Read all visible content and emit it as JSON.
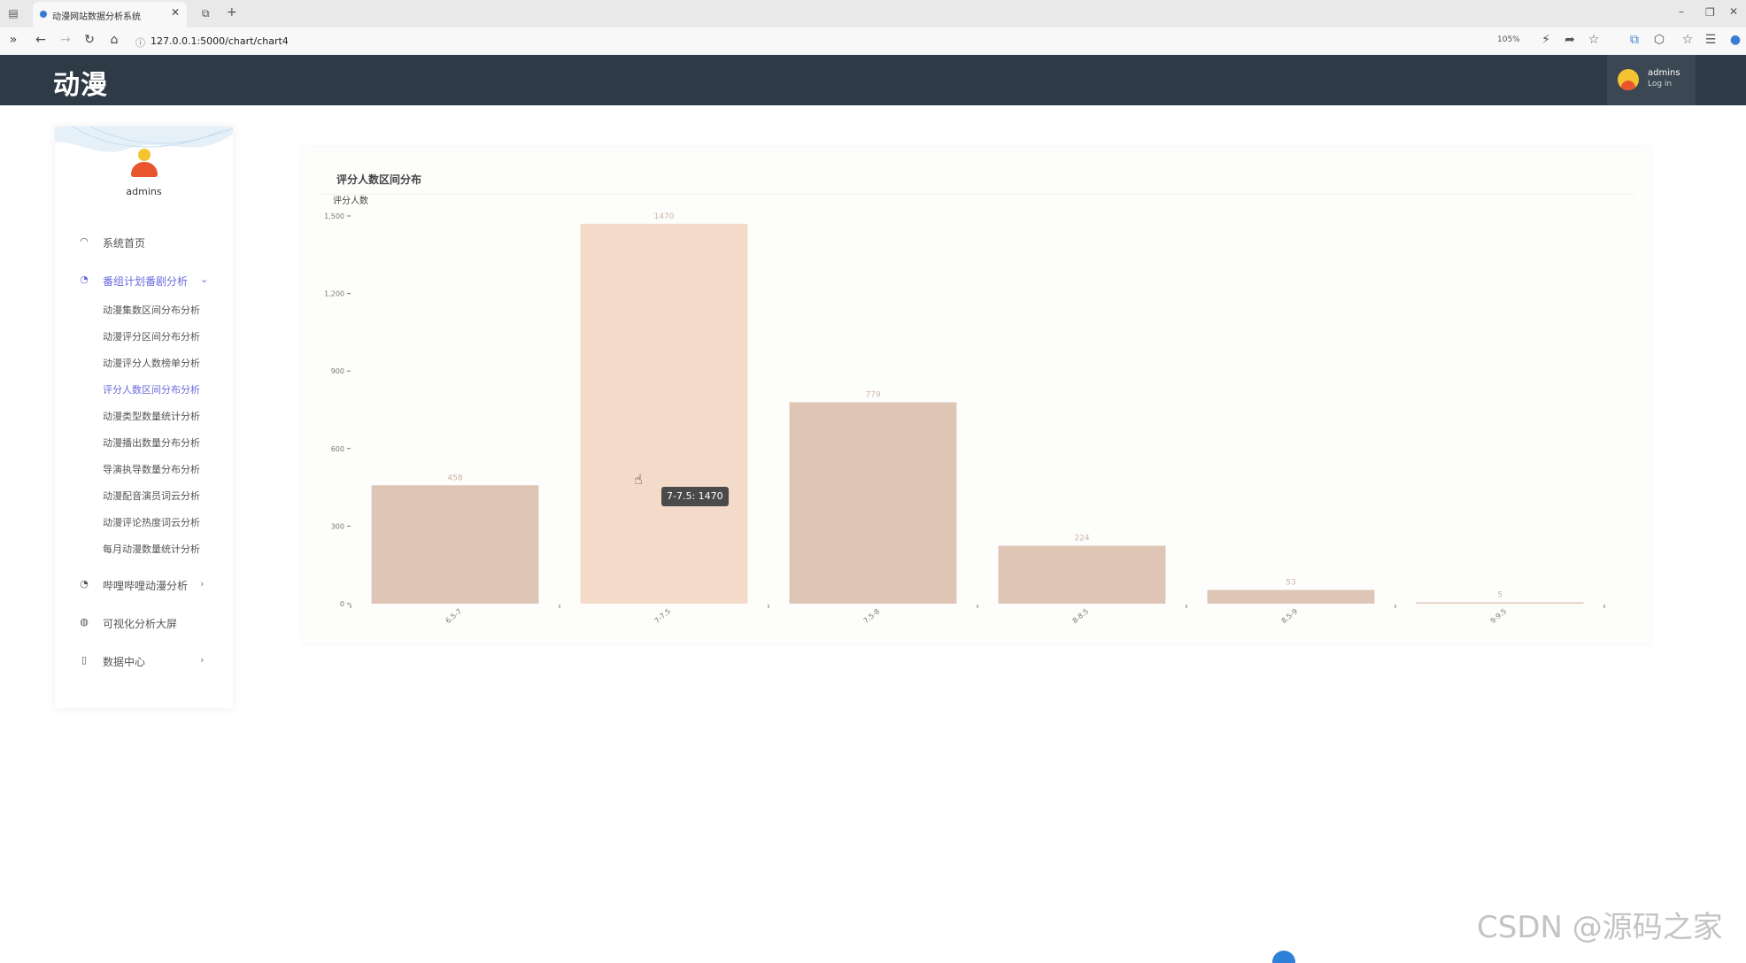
{
  "browser": {
    "tab_title": "动漫网站数据分析系统",
    "url": "127.0.0.1:5000/chart/chart4",
    "zoom": "105%"
  },
  "header": {
    "logo": "动漫",
    "user_name": "admins",
    "user_action": "Log in"
  },
  "sidebar": {
    "user_name": "admins",
    "menu": [
      {
        "label": "系统首页",
        "icon": "dashboard-icon"
      },
      {
        "label": "番组计划番剧分析",
        "icon": "palette-icon"
      },
      {
        "label": "哔哩哔哩动漫分析",
        "icon": "palette-icon"
      },
      {
        "label": "可视化分析大屏",
        "icon": "globe-icon"
      },
      {
        "label": "数据中心",
        "icon": "document-icon"
      }
    ],
    "submenu": [
      "动漫集数区间分布分析",
      "动漫评分区间分布分析",
      "动漫评分人数榜单分析",
      "评分人数区间分布分析",
      "动漫类型数量统计分析",
      "动漫播出数量分布分析",
      "导演执导数量分布分析",
      "动漫配音演员词云分析",
      "动漫评论热度词云分析",
      "每月动漫数量统计分析"
    ],
    "active_submenu_index": 3
  },
  "card": {
    "title": "评分人数区间分布"
  },
  "tooltip": "7-7.5: 1470",
  "watermark": "CSDN @源码之家",
  "chart_data": {
    "type": "bar",
    "ylabel": "评分人数",
    "categories": [
      "6.5-7",
      "7-7.5",
      "7.5-8",
      "8-8.5",
      "8.5-9",
      "9-9.5"
    ],
    "values": [
      458,
      1470,
      779,
      224,
      53,
      5
    ],
    "value_labels": [
      "458",
      "1470",
      "779",
      "224",
      "53",
      "5"
    ],
    "yticks": [
      0,
      300,
      600,
      900,
      1200,
      1500
    ],
    "ytick_labels": [
      "0",
      "300",
      "600",
      "900",
      "1,200",
      "1,500"
    ],
    "ylim": [
      0,
      1500
    ],
    "highlight_index": 1,
    "colors": {
      "bar": "#dfc5b6",
      "bar_highlight": "#f4dac9",
      "label": "#cdb5a6",
      "axis": "#777777"
    }
  }
}
